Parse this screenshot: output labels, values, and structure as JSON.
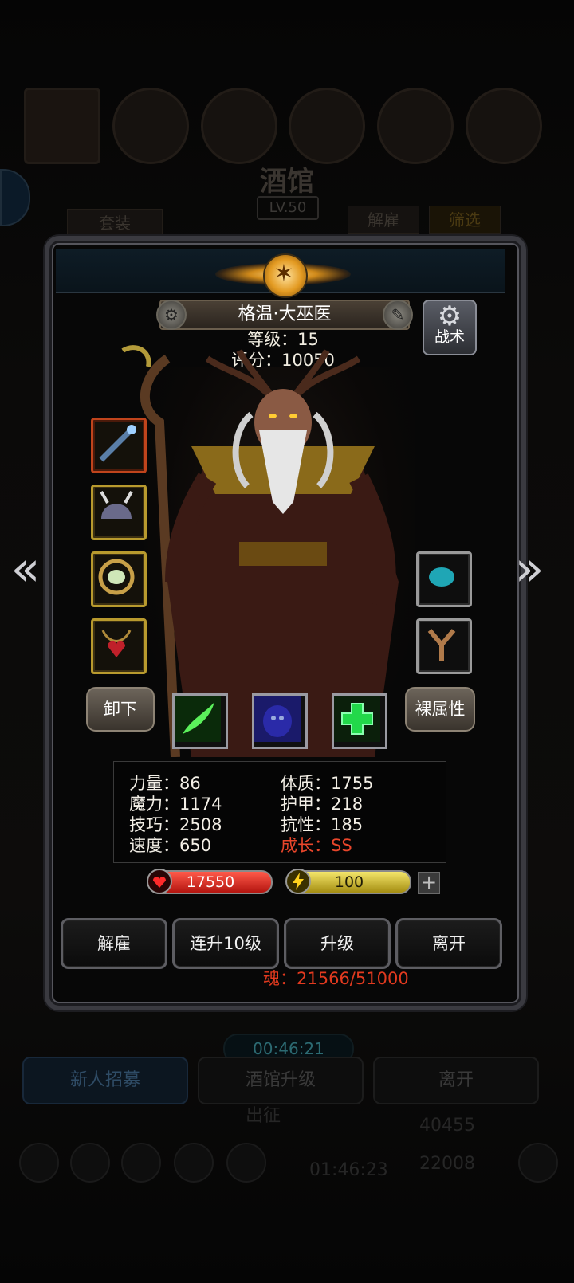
{
  "background": {
    "title": "酒馆",
    "level": "LV.50",
    "set_label": "套装",
    "dismiss_label": "解雇",
    "filter_label": "筛选",
    "bottom_buttons": [
      "新人招募",
      "酒馆升级",
      "离开"
    ],
    "timer": "00:46:21",
    "expedition": "出征",
    "timer2": "01:46:23",
    "gold": "40455",
    "gems": "22008"
  },
  "hero": {
    "name": "格温·大巫医",
    "level_text": "等级：15",
    "score_text": "评分：10050",
    "tactics_label": "战术",
    "unequip_label": "卸下",
    "naked_attr_label": "裸属性"
  },
  "stats": {
    "strength": "力量：86",
    "constitution": "体质：1755",
    "magic": "魔力：1174",
    "armor": "护甲：218",
    "skill": "技巧：2508",
    "resist": "抗性：185",
    "speed": "速度：650",
    "growth": "成长：SS"
  },
  "bars": {
    "hp": "17550",
    "energy": "100",
    "plus": "+"
  },
  "actions": [
    "解雇",
    "连升10级",
    "升级",
    "离开"
  ],
  "soul": "魂：21566/51000",
  "icons": {
    "nav_left": "«",
    "nav_right": "»",
    "gear": "⚙"
  },
  "colors": {
    "growth_red": "#e8462b",
    "soul_red": "#e23a1f",
    "slot_gold": "#b89a2e"
  }
}
